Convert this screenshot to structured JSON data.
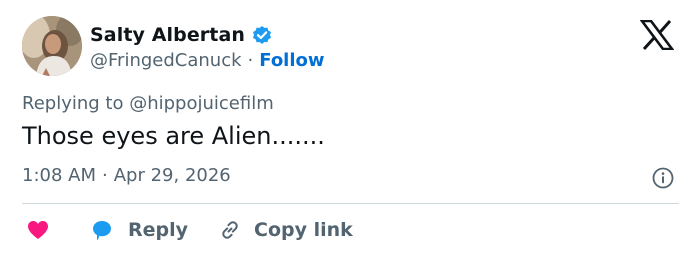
{
  "author": {
    "display_name": "Salty Albertan",
    "handle": "@FringedCanuck",
    "separator": "·",
    "follow_label": "Follow",
    "verified": true
  },
  "tweet": {
    "replying_prefix": "Replying to",
    "replying_to": "@hippojuicefilm",
    "text": "Those eyes are Alien.......",
    "time": "1:08 AM",
    "meta_separator": "·",
    "date": "Apr 29, 2026"
  },
  "actions": {
    "reply_label": "Reply",
    "copy_link_label": "Copy link"
  },
  "icons": {
    "brand": "x-logo-icon",
    "verified": "verified-badge-icon",
    "info": "info-icon",
    "like": "heart-icon",
    "reply": "speech-bubble-icon",
    "copy": "link-icon"
  },
  "colors": {
    "text": "#0f1419",
    "secondary": "#536471",
    "accent": "#006fd6",
    "verified": "#1d9bf0",
    "heart": "#f91880",
    "divider": "#cfd9de"
  }
}
